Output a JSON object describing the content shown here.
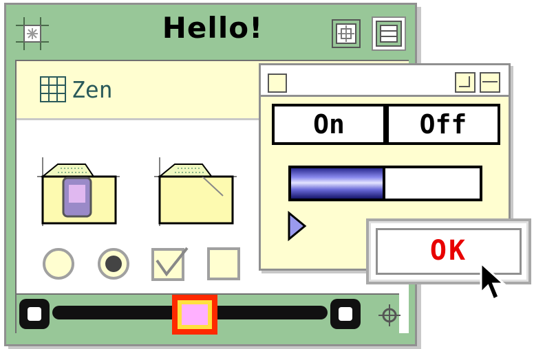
{
  "main_window": {
    "title": "Hello!",
    "folder_label": "Zen",
    "icons": {
      "close": "close-box-icon",
      "zoom": "zoom-box-icon",
      "collapse": "collapse-box-icon",
      "folder_view": "grid-view-icon",
      "resize": "resize-grip-icon"
    },
    "items": [
      {
        "name": "folder-with-document-icon"
      },
      {
        "name": "folder-icon"
      }
    ],
    "controls": [
      {
        "name": "radio-button-unselected"
      },
      {
        "name": "radio-button-selected"
      },
      {
        "name": "checkbox-checked"
      },
      {
        "name": "checkbox-unchecked"
      }
    ],
    "scroll_position": 0.5
  },
  "small_window": {
    "segments": [
      "On",
      "Off"
    ],
    "progress": 0.5
  },
  "dialog": {
    "ok_label": "OK"
  },
  "colors": {
    "window_frame": "#98c798",
    "content_bg": "#fffed0",
    "ok_text": "#e80000",
    "thumb_border": "#ff2a00",
    "thumb_fill": "#ffd0ff",
    "progress": "#4a4acc"
  }
}
